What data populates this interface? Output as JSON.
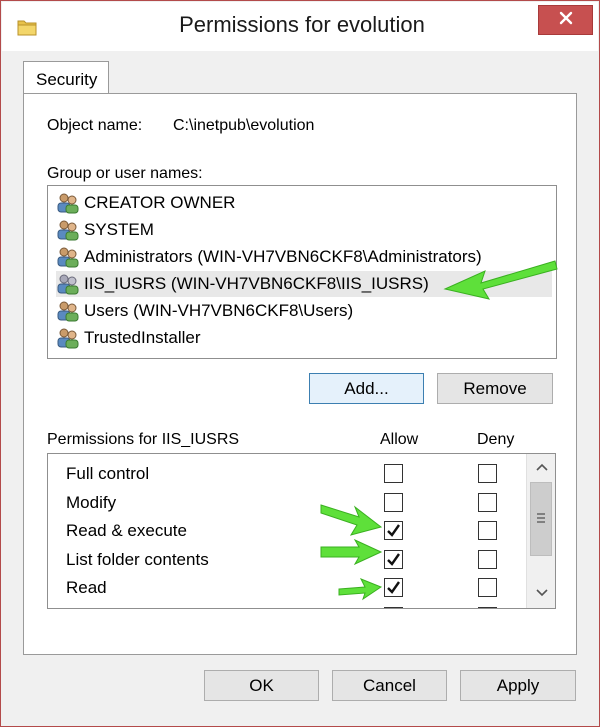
{
  "window": {
    "title": "Permissions for evolution",
    "close_glyph": "✕"
  },
  "tab": {
    "label": "Security"
  },
  "object": {
    "label": "Object name:",
    "value": "C:\\inetpub\\evolution"
  },
  "group_section": {
    "label": "Group or user names:"
  },
  "users": [
    {
      "name": "CREATOR OWNER",
      "selected": false
    },
    {
      "name": "SYSTEM",
      "selected": false
    },
    {
      "name": "Administrators (WIN-VH7VBN6CKF8\\Administrators)",
      "selected": false
    },
    {
      "name": "IIS_IUSRS (WIN-VH7VBN6CKF8\\IIS_IUSRS)",
      "selected": true
    },
    {
      "name": "Users (WIN-VH7VBN6CKF8\\Users)",
      "selected": false
    },
    {
      "name": "TrustedInstaller",
      "selected": false
    }
  ],
  "buttons": {
    "add": "Add...",
    "remove": "Remove",
    "ok": "OK",
    "cancel": "Cancel",
    "apply": "Apply"
  },
  "permissions": {
    "label": "Permissions for IIS_IUSRS",
    "allow_header": "Allow",
    "deny_header": "Deny",
    "rows": [
      {
        "name": "Full control",
        "allow": false,
        "deny": false
      },
      {
        "name": "Modify",
        "allow": false,
        "deny": false
      },
      {
        "name": "Read & execute",
        "allow": true,
        "deny": false
      },
      {
        "name": "List folder contents",
        "allow": true,
        "deny": false
      },
      {
        "name": "Read",
        "allow": true,
        "deny": false
      }
    ]
  },
  "colors": {
    "annotation_arrow": "#5ee03a",
    "close_button": "#c75050",
    "selection": "#e8e8e8"
  },
  "icons": {
    "title": "folder-icon",
    "user": "user-group-icon",
    "scroll_up": "chevron-up-icon",
    "scroll_down": "chevron-down-icon",
    "annotation": "green-arrow-annotation"
  }
}
